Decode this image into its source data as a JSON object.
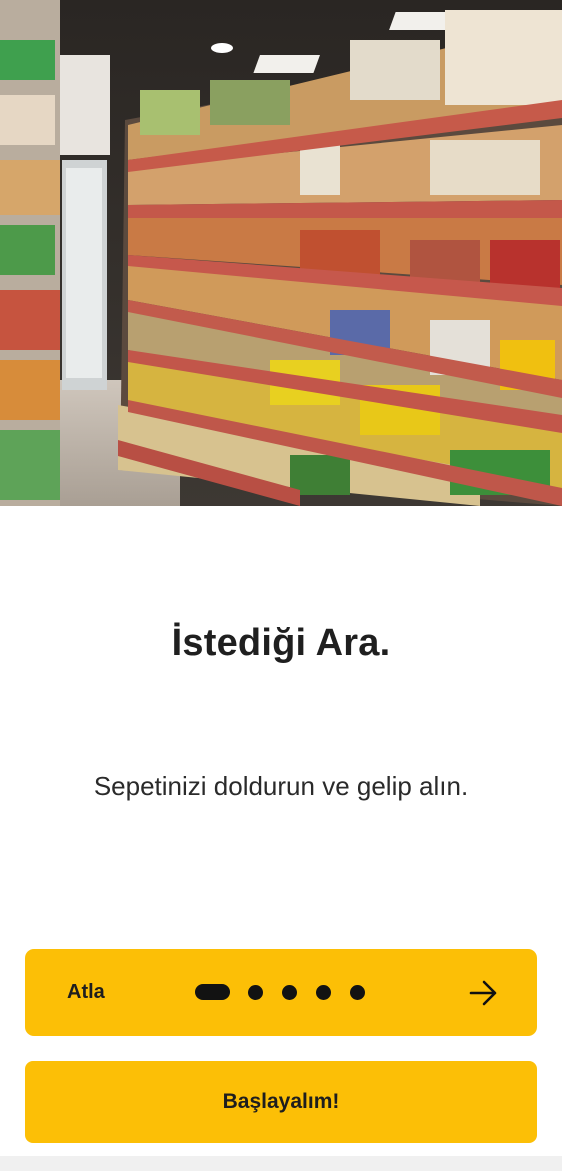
{
  "onboarding": {
    "title": "İstediği Ara.",
    "subtitle": "Sepetinizi doldurun ve gelip alın.",
    "skip_label": "Atla",
    "start_label": "Başlayalım!",
    "page_indicator": {
      "current": 1,
      "total": 5
    },
    "next_icon": "arrow-right-icon"
  },
  "hero": {
    "image": "supermarket-shelves-photo"
  },
  "colors": {
    "accent": "#fcbf06",
    "text": "#1f1f1f",
    "background": "#ffffff"
  }
}
